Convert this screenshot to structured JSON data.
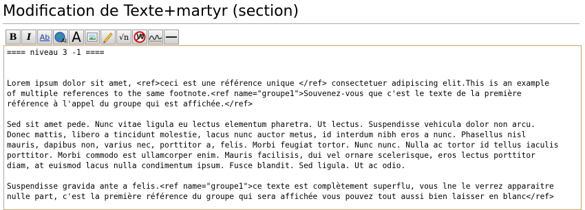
{
  "page": {
    "title": "Modification de Texte+martyr (section)"
  },
  "toolbar": {
    "buttons": [
      {
        "name": "bold-button",
        "label": "B",
        "icon": "bold-icon"
      },
      {
        "name": "italic-button",
        "label": "I",
        "icon": "italic-icon"
      },
      {
        "name": "internal-link-button",
        "label": "Ab",
        "icon": "link-icon"
      },
      {
        "name": "external-link-button",
        "label": "",
        "icon": "globe-link-icon"
      },
      {
        "name": "headline-button",
        "label": "A",
        "icon": "headline-icon"
      },
      {
        "name": "image-button",
        "label": "",
        "icon": "image-icon"
      },
      {
        "name": "media-button",
        "label": "",
        "icon": "media-icon"
      },
      {
        "name": "math-button",
        "label": "√n",
        "icon": "math-icon"
      },
      {
        "name": "nowiki-button",
        "label": "W",
        "icon": "nowiki-icon"
      },
      {
        "name": "signature-button",
        "label": "",
        "icon": "signature-icon"
      },
      {
        "name": "horizontal-line-button",
        "label": "",
        "icon": "horizontal-line-icon"
      }
    ]
  },
  "editor": {
    "lines": [
      "==== niveau 3 -1 ====",
      "",
      "",
      "Lorem ipsum dolor sit amet, <ref>ceci est une référence unique </ref> consectetuer adipiscing elit.This is an example",
      "of multiple references to the same footnote.<ref name=\"groupe1\">Souvenez-vous que c'est le texte de la première",
      "référence à l'appel du groupe qui est affichée.</ref>",
      "",
      "Sed sit amet pede. Nunc vitae ligula eu lectus elementum pharetra. Ut lectus. Suspendisse vehicula dolor non arcu.",
      "Donec mattis, libero a tincidunt molestie, lacus nunc auctor metus, id interdum nibh eros a nunc. Phasellus nisl",
      "mauris, dapibus non, varius nec, porttitor a, felis. Morbi feugiat tortor. Nunc nunc. Nulla ac tortor id tellus iaculis",
      "porttitor. Morbi commodo est ullamcorper enim. Mauris facilisis, dui vel ornare scelerisque, eros lectus porttitor",
      "diam, at euismod lacus nulla condimentum ipsum. Fusce blandit. Sed ligula. Ut ac odio.",
      "",
      "Suspendisse gravida ante a felis.<ref name=\"groupe1\">ce texte est complètement superflu, vous lne le verrez apparaitre",
      "nulle part, c'est la première référence du groupe qui sera affichée vous pouvez tout aussi bien laisser en blanc</ref>"
    ]
  }
}
